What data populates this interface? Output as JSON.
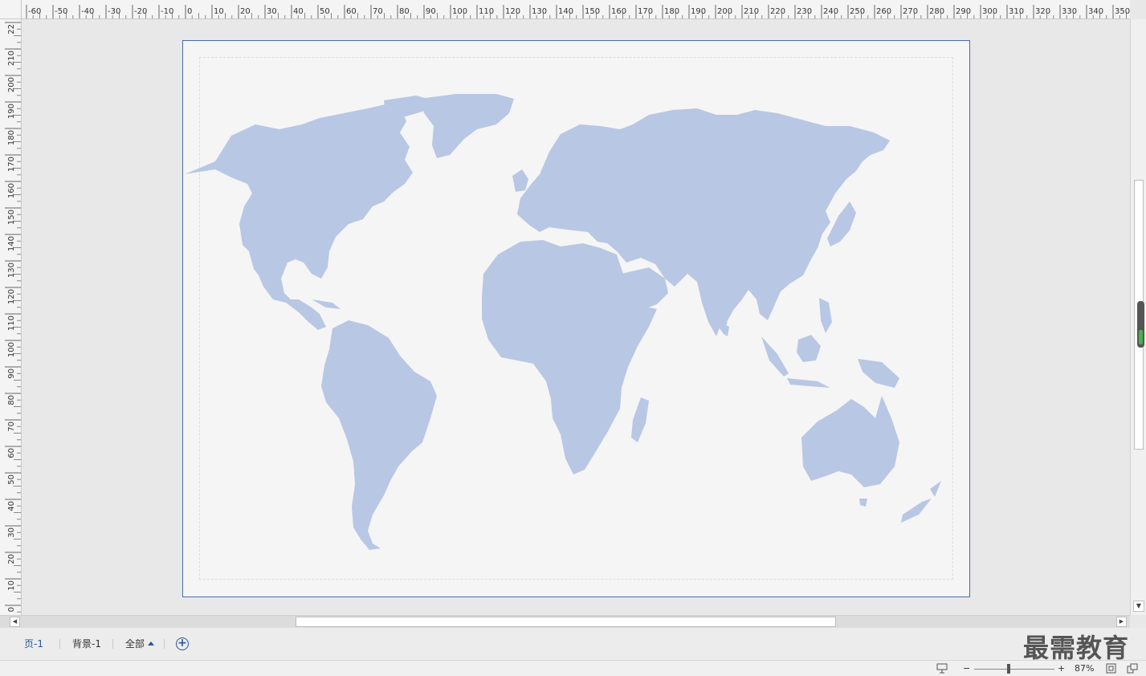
{
  "ruler": {
    "horizontal_labels": [
      "-60",
      "-50",
      "-40",
      "-30",
      "-20",
      "-10",
      "0",
      "10",
      "20",
      "30",
      "40",
      "50",
      "60",
      "70",
      "80",
      "90",
      "100",
      "110",
      "120",
      "130",
      "140",
      "150",
      "160",
      "170",
      "180",
      "190",
      "200",
      "210",
      "220",
      "230",
      "240",
      "250",
      "260",
      "270",
      "280",
      "290",
      "300",
      "310",
      "320",
      "330",
      "340",
      "350"
    ],
    "vertical_labels": [
      "22",
      "210",
      "200",
      "190",
      "180",
      "170",
      "160",
      "150",
      "140",
      "130",
      "120",
      "110",
      "100",
      "90",
      "80",
      "70",
      "60",
      "50",
      "40",
      "30",
      "20",
      "10",
      "0"
    ]
  },
  "canvas": {
    "map_color": "#b8c7e4",
    "page_border_color": "#4a6aa8"
  },
  "tabs": {
    "page1": "页-1",
    "background1": "背景-1",
    "all": "全部",
    "add_icon": "plus-circle-icon"
  },
  "watermark": "最需教育",
  "status": {
    "zoom_out": "−",
    "zoom_in": "+",
    "zoom_level": "87%",
    "zoom_fraction": 0.43
  }
}
